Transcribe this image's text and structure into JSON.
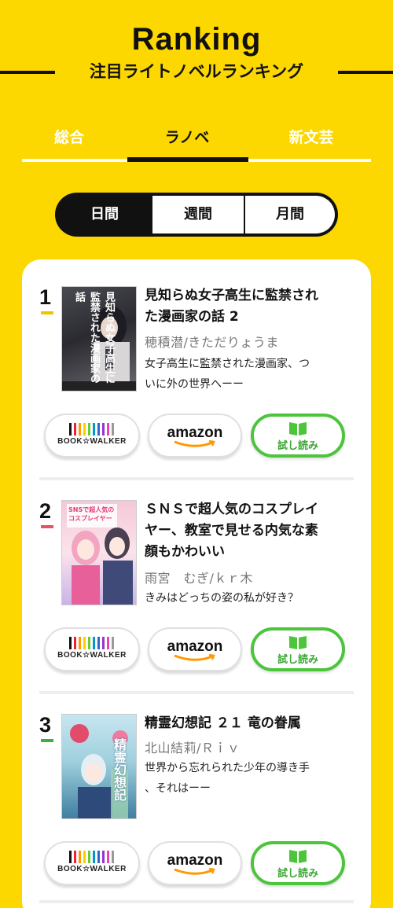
{
  "header": {
    "title": "Ranking",
    "subtitle": "注目ライトノベルランキング"
  },
  "tabs": [
    {
      "label": "総合"
    },
    {
      "label": "ラノベ"
    },
    {
      "label": "新文芸"
    }
  ],
  "period_tabs": [
    {
      "label": "日間"
    },
    {
      "label": "週間"
    },
    {
      "label": "月間"
    }
  ],
  "colors": {
    "background": "#fcd700",
    "accent_green": "#4cc43c",
    "rank1": "#f2c200",
    "rank2": "#e8506b",
    "rank3": "#3cb043"
  },
  "buttons": {
    "bookwalker": "BOOK☆WALKER",
    "amazon": "amazon",
    "trial": "試し読み"
  },
  "entries": [
    {
      "rank": "1",
      "title_lines": [
        "見知らぬ女子高生に監禁され",
        "た漫画家の話 2"
      ],
      "author": "穂積潜/きただりょうま",
      "tagline_lines": [
        "女子高生に監禁された漫画家、つ",
        "いに外の世界へーー"
      ],
      "cover_text": "見知らぬ女子高生に監禁された漫画家の話"
    },
    {
      "rank": "2",
      "title_lines": [
        "ＳＮＳで超人気のコスプレイ",
        "ヤー、教室で見せる内気な素",
        "顔もかわいい"
      ],
      "author": "雨宮　むぎ/ｋｒ木",
      "tagline_lines": [
        "きみはどっちの姿の私が好き？"
      ],
      "cover_text": "SNSで超人気のコスプレイヤー"
    },
    {
      "rank": "3",
      "title_lines": [
        "精霊幻想記 ２１ 竜の眷属"
      ],
      "author": "北山結莉/Ｒｉｖ",
      "tagline_lines": [
        "世界から忘れられた少年の導き手",
        "、それはーー"
      ],
      "cover_text": "精霊幻想記"
    }
  ]
}
